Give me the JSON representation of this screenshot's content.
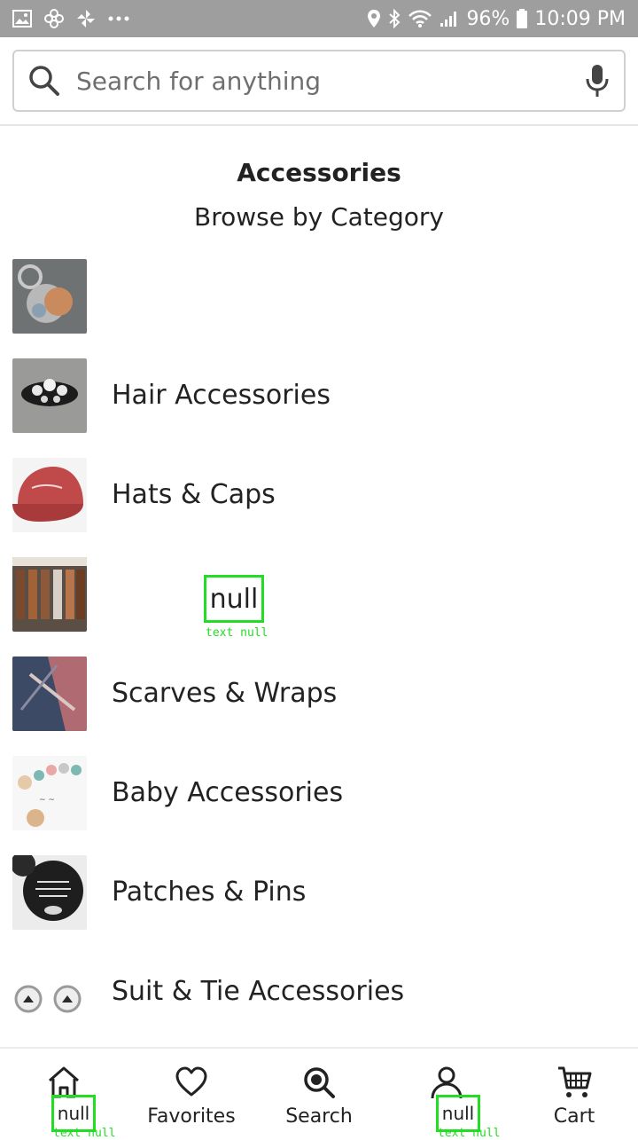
{
  "status_bar": {
    "battery": "96%",
    "time": "10:09 PM",
    "left_icons": [
      "gallery-icon",
      "pinwheel-icon",
      "flower-icon",
      "more-dots-icon"
    ],
    "right_icons": [
      "location-icon",
      "bluetooth-icon",
      "wifi-icon",
      "signal-icon",
      "battery-icon"
    ]
  },
  "search": {
    "placeholder": "Search for anything"
  },
  "page": {
    "heading": "Accessories",
    "subheading": "Browse by Category"
  },
  "categories": [
    {
      "label": "",
      "thumb": "keychain-charm"
    },
    {
      "label": "Hair Accessories",
      "thumb": "hair-clip"
    },
    {
      "label": "Hats & Caps",
      "thumb": "red-cap"
    },
    {
      "label": "null",
      "thumb": "leather-keychains"
    },
    {
      "label": "Scarves & Wraps",
      "thumb": "plaid-scarf"
    },
    {
      "label": "Baby Accessories",
      "thumb": "teething-beads"
    },
    {
      "label": "Patches & Pins",
      "thumb": "pin-button"
    },
    {
      "label": "Suit & Tie Accessories",
      "thumb": "cufflinks"
    }
  ],
  "overlay_caption": "text null",
  "bottom_nav": [
    {
      "label": "null",
      "icon": "home-icon"
    },
    {
      "label": "Favorites",
      "icon": "heart-icon"
    },
    {
      "label": "Search",
      "icon": "search-icon"
    },
    {
      "label": "null",
      "icon": "profile-icon"
    },
    {
      "label": "Cart",
      "icon": "cart-icon"
    }
  ],
  "colors": {
    "status_bar_bg": "#9e9e9e",
    "overlay_green": "#22dd22"
  }
}
